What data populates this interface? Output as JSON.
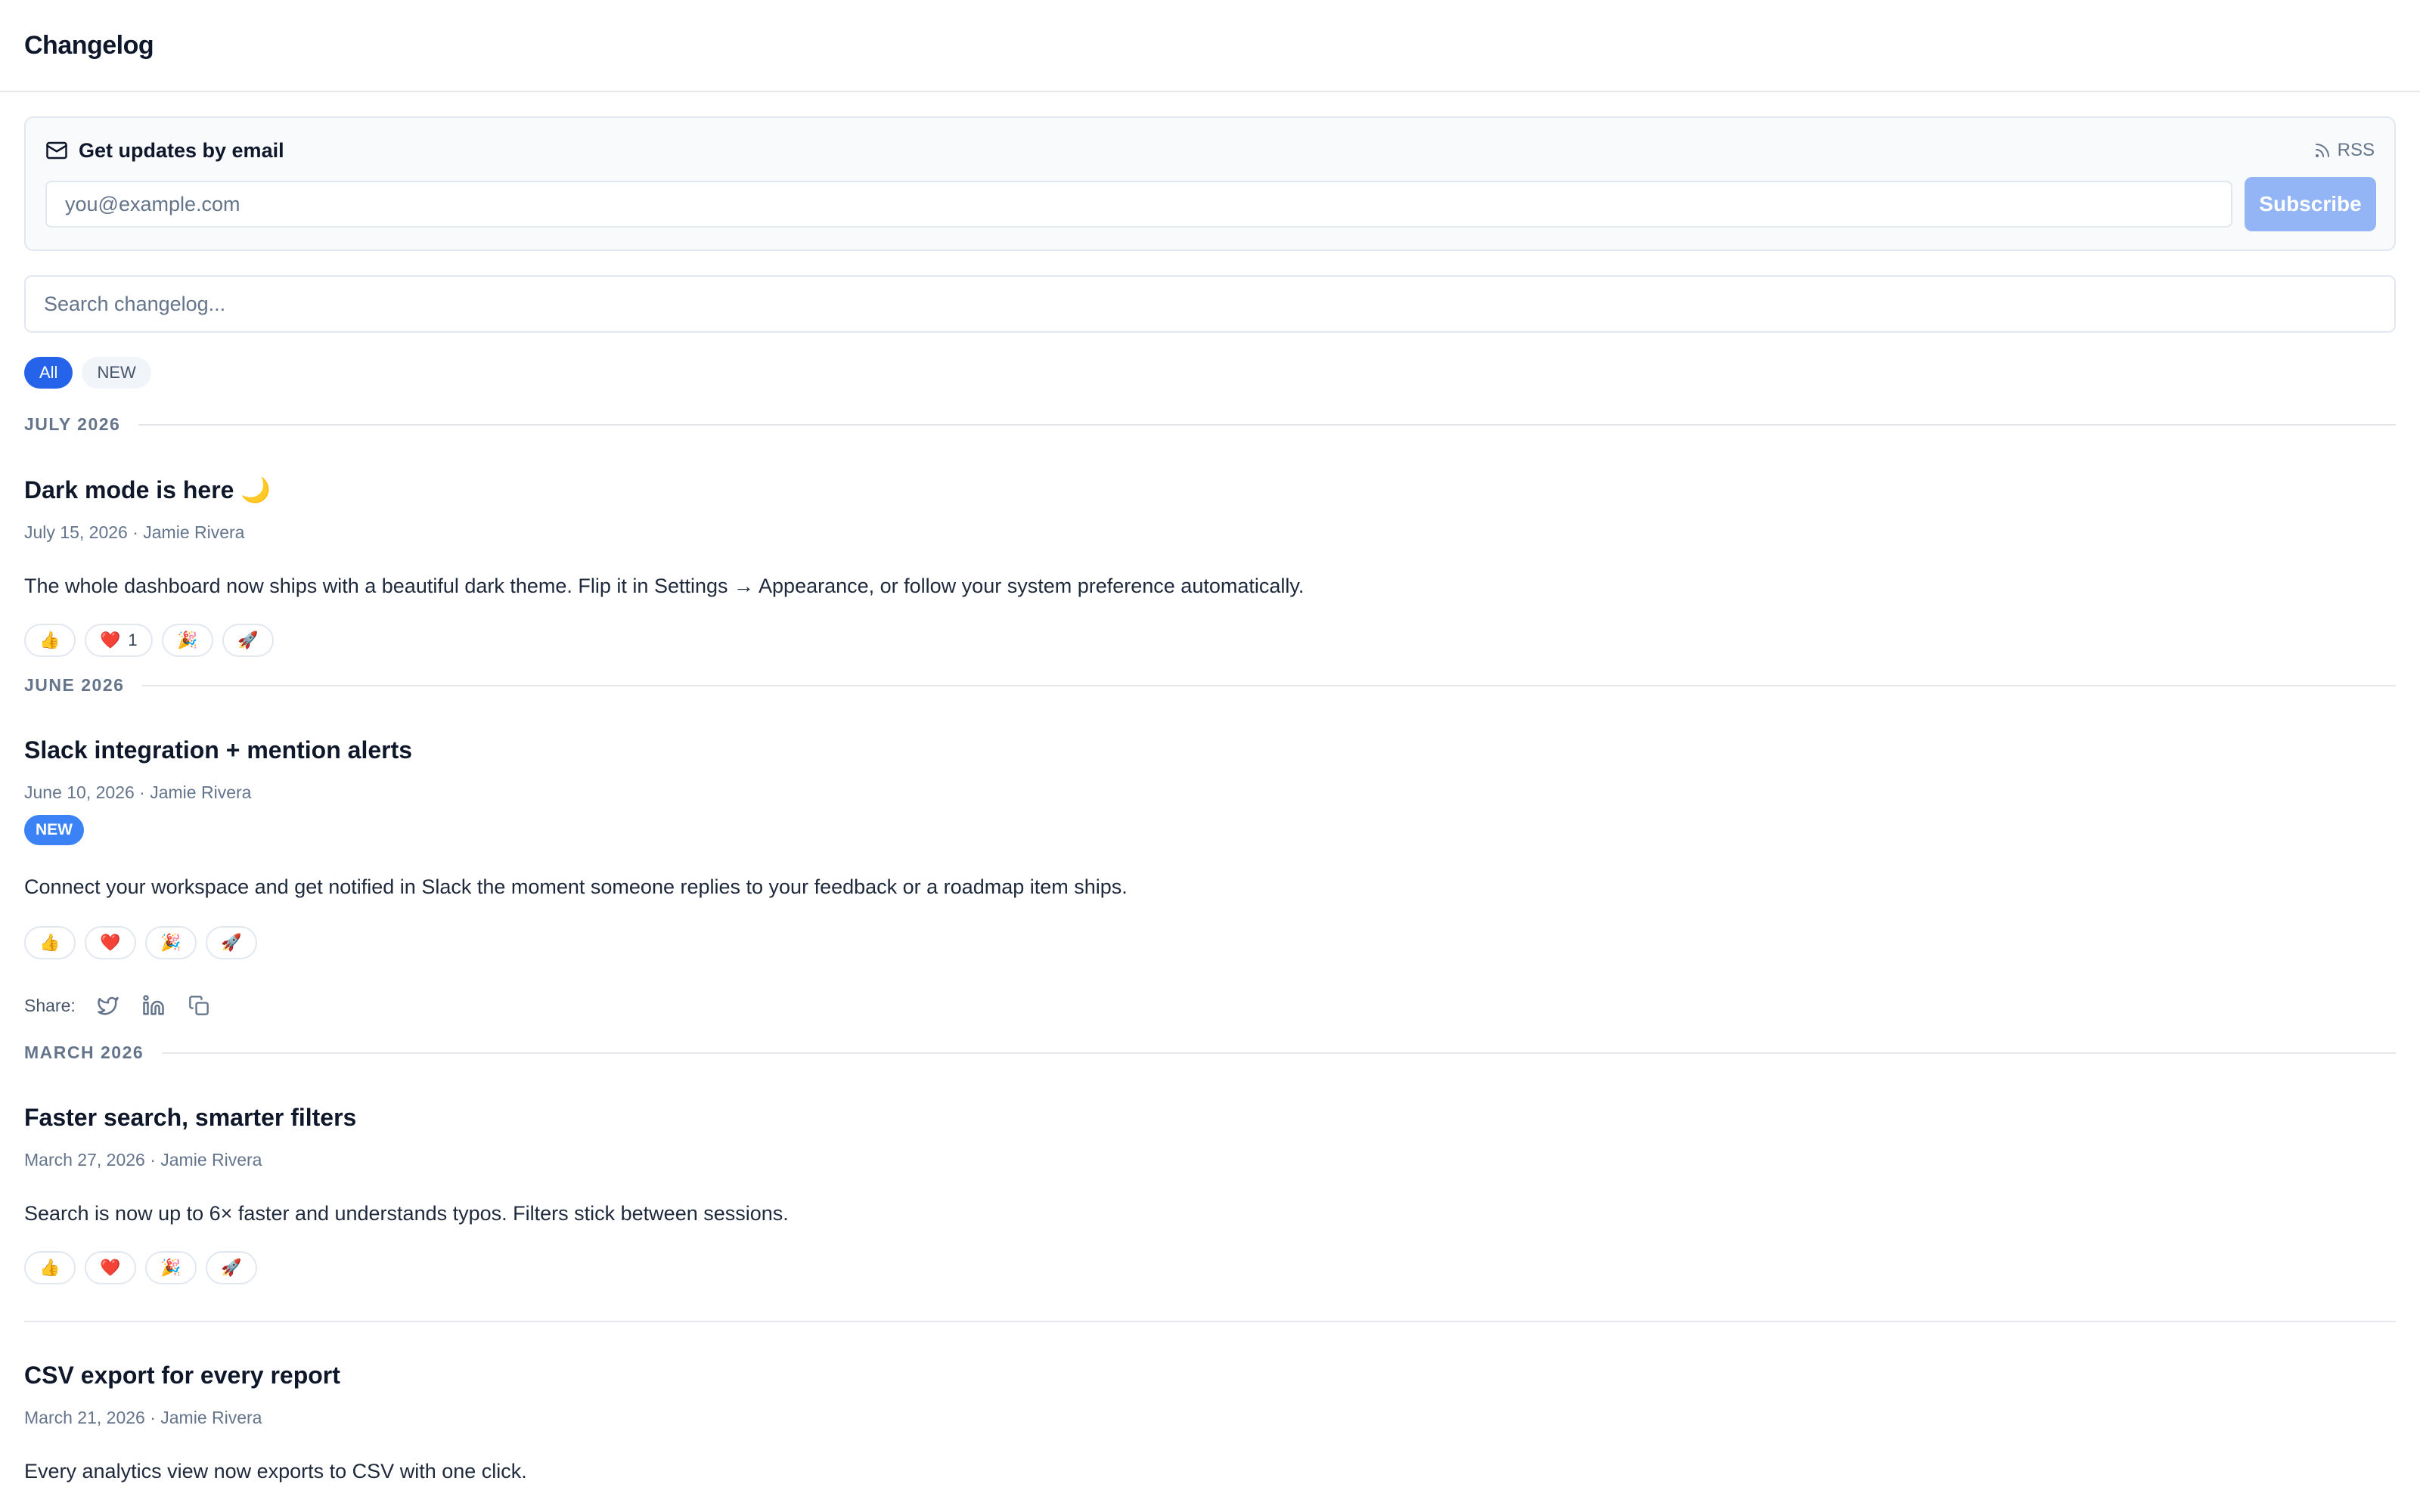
{
  "header": {
    "title": "Changelog"
  },
  "subscribe": {
    "title": "Get updates by email",
    "rss_label": "RSS",
    "email_placeholder": "you@example.com",
    "button_label": "Subscribe"
  },
  "search": {
    "placeholder": "Search changelog..."
  },
  "filters": [
    {
      "label": "All",
      "active": true
    },
    {
      "label": "NEW",
      "active": false
    }
  ],
  "months": [
    "JULY 2026",
    "JUNE 2026",
    "MARCH 2026"
  ],
  "entries": [
    {
      "title": "Dark mode is here 🌙",
      "meta": "July 15, 2026 · Jamie Rivera",
      "body": "The whole dashboard now ships with a beautiful dark theme. Flip it in Settings → Appearance, or follow your system preference automatically.",
      "reactions": [
        {
          "emoji": "👍",
          "count": ""
        },
        {
          "emoji": "❤️",
          "count": "1"
        },
        {
          "emoji": "🎉",
          "count": ""
        },
        {
          "emoji": "🚀",
          "count": ""
        }
      ]
    },
    {
      "title": "Slack integration + mention alerts",
      "meta": "June 10, 2026 · Jamie Rivera",
      "badge": "NEW",
      "body": "Connect your workspace and get notified in Slack the moment someone replies to your feedback or a roadmap item ships.",
      "reactions": [
        {
          "emoji": "👍",
          "count": ""
        },
        {
          "emoji": "❤️",
          "count": ""
        },
        {
          "emoji": "🎉",
          "count": ""
        },
        {
          "emoji": "🚀",
          "count": ""
        }
      ],
      "share_label": "Share:"
    },
    {
      "title": "Faster search, smarter filters",
      "meta": "March 27, 2026 · Jamie Rivera",
      "body": "Search is now up to 6× faster and understands typos. Filters stick between sessions.",
      "reactions": [
        {
          "emoji": "👍",
          "count": ""
        },
        {
          "emoji": "❤️",
          "count": ""
        },
        {
          "emoji": "🎉",
          "count": ""
        },
        {
          "emoji": "🚀",
          "count": ""
        }
      ]
    },
    {
      "title": "CSV export for every report",
      "meta": "March 21, 2026 · Jamie Rivera",
      "body": "Every analytics view now exports to CSV with one click."
    }
  ],
  "icons": {
    "mail": "mail-icon",
    "rss": "rss-icon",
    "twitter": "twitter-icon",
    "linkedin": "linkedin-icon",
    "copy": "copy-link-icon"
  },
  "colors": {
    "accent": "#2563eb",
    "badge": "#3b82f6",
    "subscribe_disabled": "#93b4f5",
    "muted": "#64748b"
  }
}
